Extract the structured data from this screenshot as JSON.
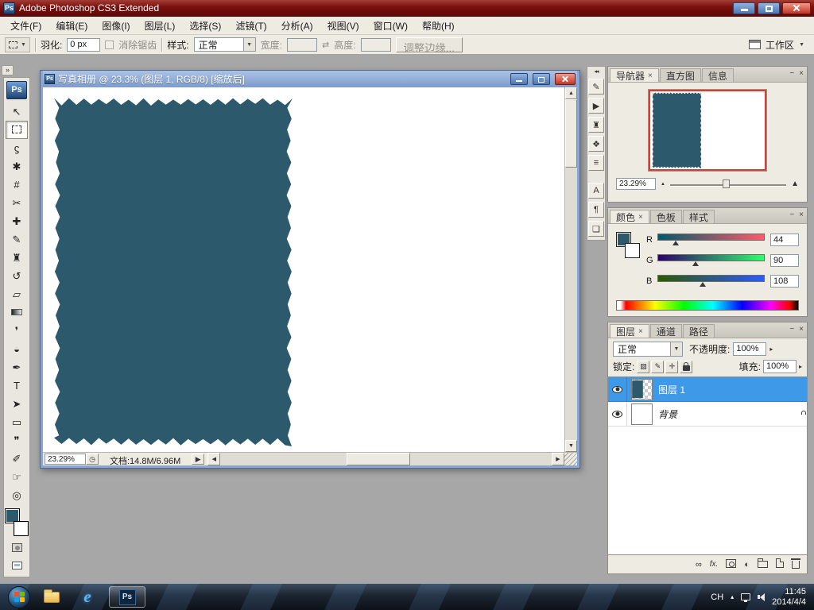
{
  "colors": {
    "teal": "#2C5A6C",
    "selection_blue": "#3E9AE8",
    "title_red": "#7A100E",
    "workspace_gray": "#A7A7A7",
    "viewbox_red": "#E03A2F"
  },
  "glyphs": {
    "up": "▲",
    "down": "▼",
    "left": "◀",
    "right": "▶",
    "menu_arrow": "▼",
    "mini_arrow": "▸",
    "play": "▶",
    "expand": "»",
    "collapse": "◂◂",
    "caret": "▴",
    "swap": "⇄",
    "close": "×",
    "minimize": "−",
    "clock": "◷",
    "mountain": "▲"
  },
  "titlebar": {
    "title": "Adobe Photoshop CS3 Extended",
    "app_icon_label": "Ps"
  },
  "menu_bar": {
    "items": [
      {
        "id": "file",
        "label": "文件(F)"
      },
      {
        "id": "edit",
        "label": "编辑(E)"
      },
      {
        "id": "image",
        "label": "图像(I)"
      },
      {
        "id": "layer",
        "label": "图层(L)"
      },
      {
        "id": "select",
        "label": "选择(S)"
      },
      {
        "id": "filter",
        "label": "滤镜(T)"
      },
      {
        "id": "analysis",
        "label": "分析(A)"
      },
      {
        "id": "view",
        "label": "视图(V)"
      },
      {
        "id": "window",
        "label": "窗口(W)"
      },
      {
        "id": "help",
        "label": "帮助(H)"
      }
    ]
  },
  "options_bar": {
    "feather_label": "羽化:",
    "feather_value": "0 px",
    "antialias_label": "消除锯齿",
    "style_label": "样式:",
    "style_value": "正常",
    "width_label": "宽度:",
    "height_label": "高度:",
    "refine_edge_label": "调整边缘...",
    "workspace_label": "工作区"
  },
  "toolbox": {
    "ps_logo": "Ps",
    "tools": [
      {
        "name": "move-tool",
        "glyph": "↖"
      },
      {
        "name": "rectangular-marquee-tool",
        "style": "marquee",
        "selected": true
      },
      {
        "name": "lasso-tool",
        "glyph": "ϛ"
      },
      {
        "name": "quick-selection-tool",
        "glyph": "✱"
      },
      {
        "name": "crop-tool",
        "glyph": "#"
      },
      {
        "name": "slice-tool",
        "glyph": "✂"
      },
      {
        "name": "healing-brush-tool",
        "glyph": "✚"
      },
      {
        "name": "brush-tool",
        "glyph": "✎"
      },
      {
        "name": "clone-stamp-tool",
        "glyph": "♜"
      },
      {
        "name": "history-brush-tool",
        "glyph": "↺"
      },
      {
        "name": "eraser-tool",
        "glyph": "▱"
      },
      {
        "name": "gradient-tool",
        "style": "gradient"
      },
      {
        "name": "blur-tool",
        "glyph": "❜"
      },
      {
        "name": "dodge-tool",
        "glyph": "◒"
      },
      {
        "name": "pen-tool",
        "glyph": "✒"
      },
      {
        "name": "type-tool",
        "glyph": "T"
      },
      {
        "name": "path-selection-tool",
        "glyph": "➤"
      },
      {
        "name": "shape-tool",
        "glyph": "▭"
      },
      {
        "name": "notes-tool",
        "glyph": "❞"
      },
      {
        "name": "eyedropper-tool",
        "glyph": "✐"
      },
      {
        "name": "hand-tool",
        "glyph": "☞"
      },
      {
        "name": "zoom-tool",
        "glyph": "◎"
      }
    ]
  },
  "document_window": {
    "title": "写真相册 @ 23.3% (图层 1, RGB/8) [缩放后]",
    "status_zoom": "23.29%",
    "status_doc": "文档:14.8M/6.96M"
  },
  "icon_strip": {
    "items": [
      {
        "name": "brushes",
        "glyph": "✎"
      },
      {
        "name": "animation",
        "glyph": "▶"
      },
      {
        "name": "clone-source",
        "glyph": "♜"
      },
      {
        "name": "styles",
        "glyph": "❖"
      },
      {
        "name": "info",
        "glyph": "≡"
      },
      {
        "name": "character",
        "glyph": "A",
        "gapBefore": true
      },
      {
        "name": "paragraph",
        "glyph": "¶"
      },
      {
        "name": "layer-comps",
        "glyph": "❏"
      }
    ]
  },
  "panels": {
    "navigator": {
      "tabs": [
        {
          "id": "navigator",
          "label": "导航器",
          "active": true
        },
        {
          "id": "histogram",
          "label": "直方图"
        },
        {
          "id": "info",
          "label": "信息"
        }
      ],
      "zoom_value": "23.29%"
    },
    "color": {
      "tabs": [
        {
          "id": "color",
          "label": "颜色",
          "active": true
        },
        {
          "id": "swatches",
          "label": "色板"
        },
        {
          "id": "styles",
          "label": "样式"
        }
      ],
      "channels": [
        {
          "label": "R",
          "value": 44
        },
        {
          "label": "G",
          "value": 90
        },
        {
          "label": "B",
          "value": 108
        }
      ],
      "max": 255
    },
    "layers": {
      "tabs": [
        {
          "id": "layers",
          "label": "图层",
          "active": true
        },
        {
          "id": "channels",
          "label": "通道"
        },
        {
          "id": "paths",
          "label": "路径"
        }
      ],
      "blend_mode": "正常",
      "opacity_label": "不透明度:",
      "opacity_value": "100%",
      "lock_label": "锁定:",
      "fill_label": "填充:",
      "fill_value": "100%",
      "lock_icons": [
        {
          "name": "lock-transparent-icon",
          "glyph": "▨"
        },
        {
          "name": "lock-pixels-icon",
          "glyph": "✎"
        },
        {
          "name": "lock-position-icon",
          "glyph": "✛"
        },
        {
          "name": "lock-all-icon",
          "css": "css-lock"
        }
      ],
      "rows": [
        {
          "name": "图层 1",
          "selected": true,
          "visible": true,
          "thumb": "image"
        },
        {
          "name": "背景",
          "visible": true,
          "locked": true,
          "italic": true,
          "thumb": "white"
        }
      ],
      "bottom_icons": [
        {
          "name": "link-layers-icon",
          "glyph": "∞"
        },
        {
          "name": "layer-style-icon",
          "glyph": "fx.",
          "fx": true
        },
        {
          "name": "layer-mask-icon",
          "css": "ico-mask"
        },
        {
          "name": "adjustment-layer-icon",
          "glyph": "◐"
        },
        {
          "name": "layer-group-icon",
          "css": "ico-folder"
        },
        {
          "name": "new-layer-icon",
          "css": "ico-page"
        },
        {
          "name": "delete-layer-icon",
          "css": "ico-trash"
        }
      ]
    }
  },
  "taskbar": {
    "ps_button_label": "Ps",
    "tray": {
      "lang": "CH",
      "time": "11:45",
      "date": "2014/4/4"
    }
  }
}
